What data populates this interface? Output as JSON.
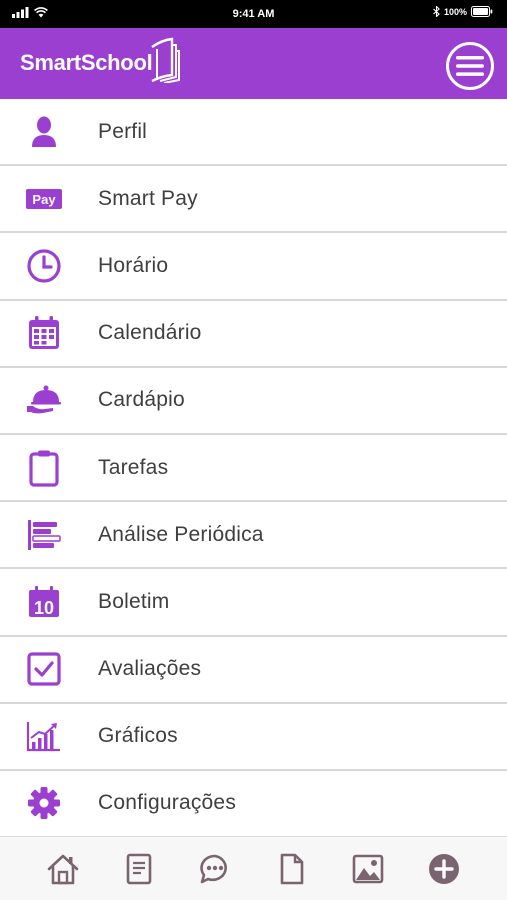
{
  "status_bar": {
    "time": "9:41 AM",
    "battery": "100%"
  },
  "header": {
    "brand": "SmartSchool"
  },
  "menu": {
    "items": [
      {
        "label": "Perfil",
        "icon": "user-icon"
      },
      {
        "label": "Smart Pay",
        "icon": "pay-icon",
        "icon_text": "Pay"
      },
      {
        "label": "Horário",
        "icon": "clock-icon"
      },
      {
        "label": "Calendário",
        "icon": "calendar-icon"
      },
      {
        "label": "Cardápio",
        "icon": "serving-dish-icon"
      },
      {
        "label": "Tarefas",
        "icon": "clipboard-icon"
      },
      {
        "label": "Análise Periódica",
        "icon": "bar-list-icon"
      },
      {
        "label": "Boletim",
        "icon": "report-card-icon",
        "icon_text": "10"
      },
      {
        "label": "Avaliações",
        "icon": "checkbox-icon"
      },
      {
        "label": "Gráficos",
        "icon": "growth-chart-icon"
      },
      {
        "label": "Configurações",
        "icon": "gear-icon"
      }
    ]
  },
  "tab_bar": {
    "tabs": [
      "home-icon",
      "notes-icon",
      "chat-icon",
      "document-icon",
      "image-icon",
      "add-icon"
    ]
  },
  "colors": {
    "accent": "#9b3fd1",
    "tab_icon": "#7a6470",
    "text": "#3f3f3f"
  }
}
